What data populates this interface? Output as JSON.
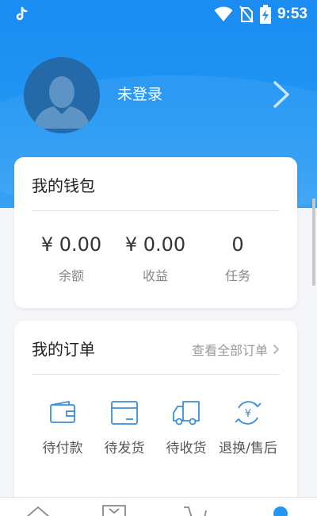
{
  "status_bar": {
    "time": "9:53",
    "icons": [
      "tiktok-icon",
      "wifi-icon",
      "no-sim-icon",
      "battery-charging-icon"
    ]
  },
  "profile": {
    "username": "未登录",
    "avatar_icon": "user-avatar-icon"
  },
  "wallet": {
    "title": "我的钱包",
    "stats": [
      {
        "value": "¥ 0.00",
        "label": "余额"
      },
      {
        "value": "¥ 0.00",
        "label": "收益"
      },
      {
        "value": "0",
        "label": "任务"
      }
    ]
  },
  "orders": {
    "title": "我的订单",
    "view_all": "查看全部订单",
    "items": [
      {
        "label": "待付款",
        "icon": "wallet-icon"
      },
      {
        "label": "待发货",
        "icon": "package-icon"
      },
      {
        "label": "待收货",
        "icon": "truck-icon"
      },
      {
        "label": "退换/售后",
        "icon": "refund-icon"
      }
    ]
  },
  "bottom_nav": {
    "icons": [
      "home-icon",
      "shop-icon",
      "cart-icon",
      "profile-icon"
    ]
  },
  "colors": {
    "primary": "#2196f3",
    "icon_accent": "#3a8fd8"
  }
}
